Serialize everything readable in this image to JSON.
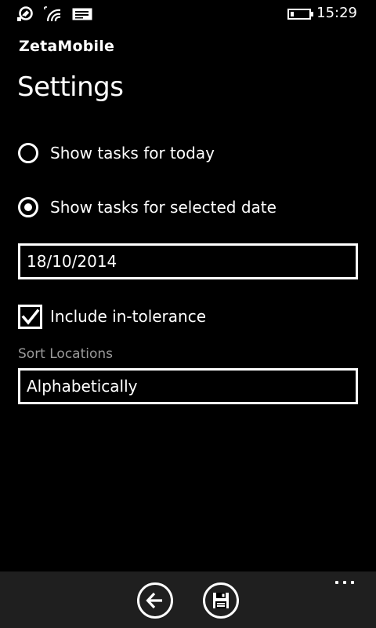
{
  "status_bar": {
    "time": "15:29",
    "icons": [
      "notification-icon",
      "wifi-signal-icon",
      "message-icon",
      "battery-icon"
    ]
  },
  "app": {
    "name": "ZetaMobile"
  },
  "page": {
    "title": "Settings"
  },
  "options": {
    "today": {
      "label": "Show tasks for today",
      "selected": false
    },
    "selected_date": {
      "label": "Show tasks for selected date",
      "selected": true
    }
  },
  "date_field": {
    "value": "18/10/2014"
  },
  "include_in_tolerance": {
    "label": "Include in-tolerance",
    "checked": true
  },
  "sort_locations": {
    "label": "Sort Locations",
    "value": "Alphabetically"
  },
  "app_bar": {
    "buttons": [
      "back-icon",
      "save-icon"
    ],
    "more": "more-icon"
  },
  "colors": {
    "background": "#000000",
    "foreground": "#ffffff",
    "label_gray": "#9a9a9a",
    "app_bar": "#1f1f1f"
  }
}
